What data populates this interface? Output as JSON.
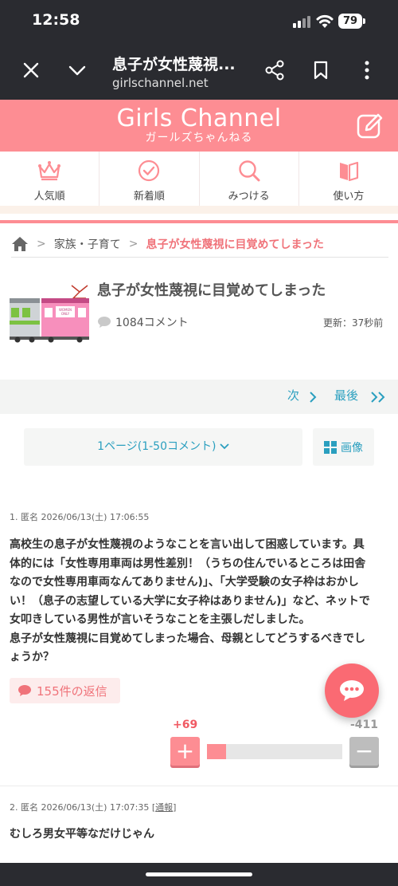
{
  "status_bar": {
    "time": "12:58",
    "battery": "79"
  },
  "browser": {
    "page_title": "息子が女性蔑視...",
    "url": "girlschannel.net"
  },
  "site": {
    "logo_en": "Girls Channel",
    "logo_jp": "ガールズちゃんねる"
  },
  "nav": [
    {
      "label": "人気順",
      "icon": "crown-icon"
    },
    {
      "label": "新着順",
      "icon": "check-clock-icon"
    },
    {
      "label": "みつける",
      "icon": "search-icon"
    },
    {
      "label": "使い方",
      "icon": "book-icon"
    }
  ],
  "breadcrumb": {
    "category": "家族・子育て",
    "current": "息子が女性蔑視に目覚めてしまった"
  },
  "article": {
    "title": "息子が女性蔑視に目覚めてしまった",
    "comment_count": "1084コメント",
    "updated": "更新：37秒前"
  },
  "pager": {
    "next": "次",
    "last": "最後"
  },
  "page_select": "1ページ(1-50コメント)",
  "image_button": "画像",
  "comments": [
    {
      "meta": "1. 匿名 2026/06/13(土) 17:06:55",
      "lines": [
        "高校生の息子が女性蔑視のようなことを言い出して困惑しています。具",
        "体的には「女性専用車両は男性差別！（うちの住んでいるところは田舎",
        "なので女性専用車両なんてありません)」、「大学受験の女子枠はおかし",
        "い！（息子の志望している大学に女子枠はありません)」など、ネットで",
        "女叩きしている男性が言いそうなことを主張しだしました。",
        "息子が女性蔑視に目覚めてしまった場合、母親としてどうするべきでし",
        "ょうか？"
      ],
      "replies": "155件の返信",
      "plus": "+69",
      "minus": "-411",
      "plus_ratio": 0.144
    },
    {
      "meta": "2. 匿名 2026/06/13(土) 17:07:35",
      "report": "通報",
      "lines": [
        "むしろ男女平等なだけじゃん"
      ]
    }
  ],
  "colors": {
    "brand_pink": "#fd8d93",
    "link_blue": "#2a9fbf",
    "dark_bar": "#2a2b30"
  }
}
